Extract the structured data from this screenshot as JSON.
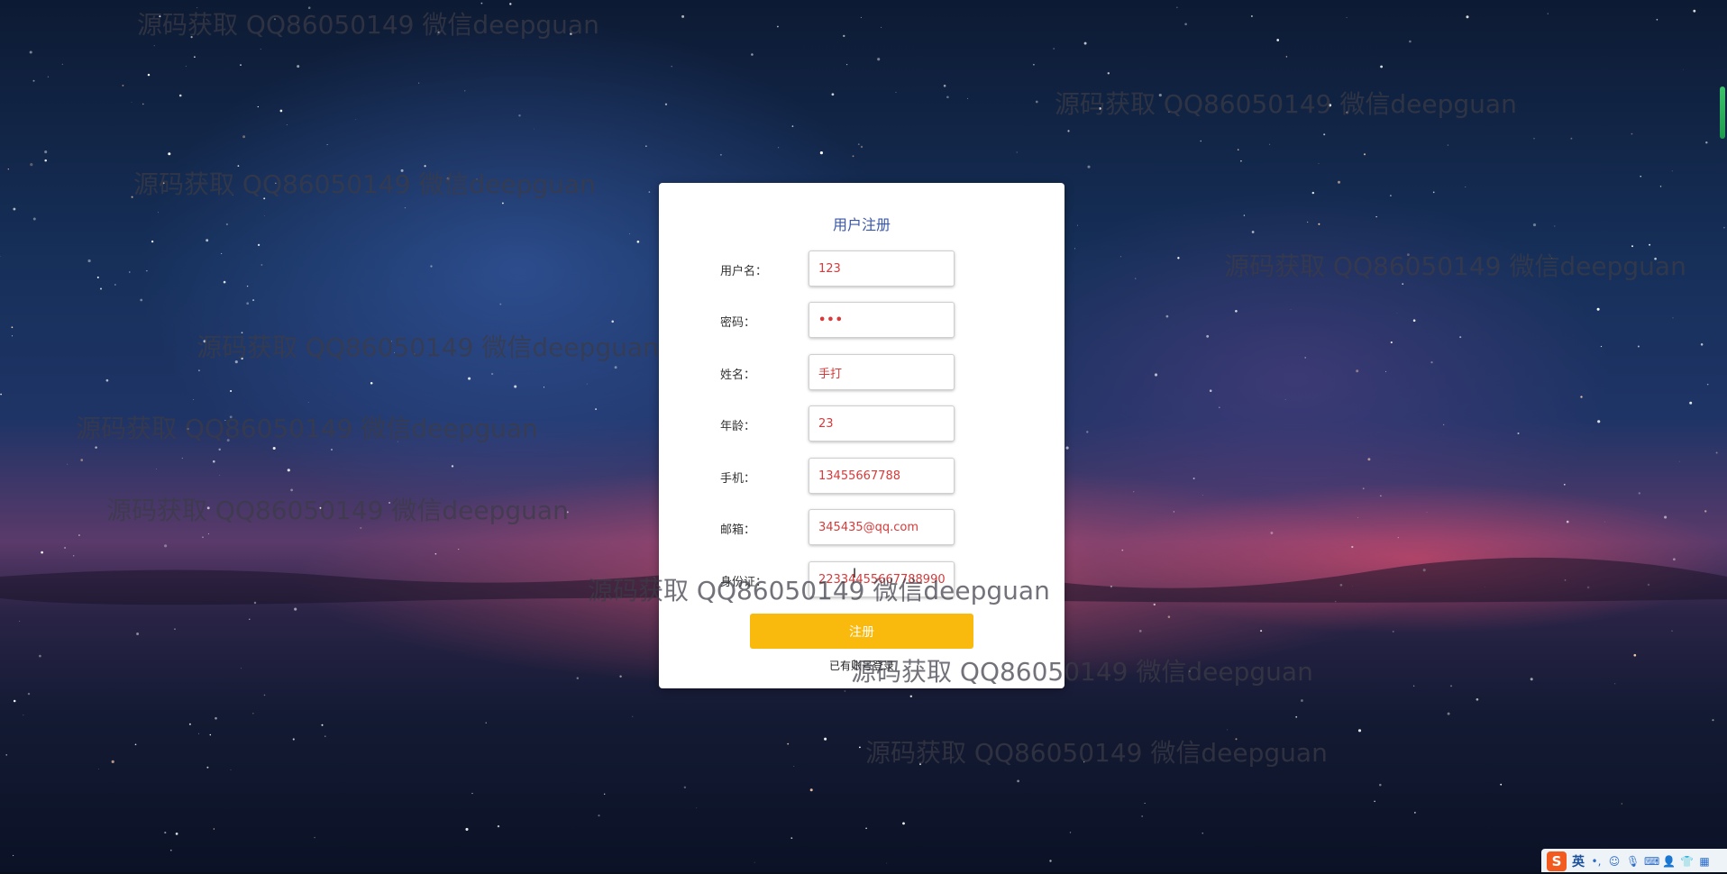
{
  "watermark_text": "源码获取 QQ86050149 微信deepguan",
  "form": {
    "title": "用户注册",
    "fields": [
      {
        "label": "用户名：",
        "value": "123",
        "type": "text"
      },
      {
        "label": "密码：",
        "value": "•••",
        "type": "password"
      },
      {
        "label": "姓名：",
        "value": "手打",
        "type": "text"
      },
      {
        "label": "年龄：",
        "value": "23",
        "type": "text"
      },
      {
        "label": "手机：",
        "value": "13455667788",
        "type": "text"
      },
      {
        "label": "邮箱：",
        "value": "345435@qq.com",
        "type": "text"
      },
      {
        "label": "身份证：",
        "value": "22334455667788990",
        "type": "text"
      }
    ],
    "submit_label": "注册",
    "login_link_text": "已有账号登录"
  },
  "ime": {
    "logo": "S",
    "mode_label": "英",
    "icons": [
      "punctuation-icon",
      "emoji-icon",
      "microphone-icon",
      "keyboard-icon",
      "user-icon",
      "shirt-icon",
      "grid-icon"
    ]
  },
  "colors": {
    "card_title": "#3b57a8",
    "input_text": "#d63a3a",
    "submit_button": "#f9b90d"
  }
}
